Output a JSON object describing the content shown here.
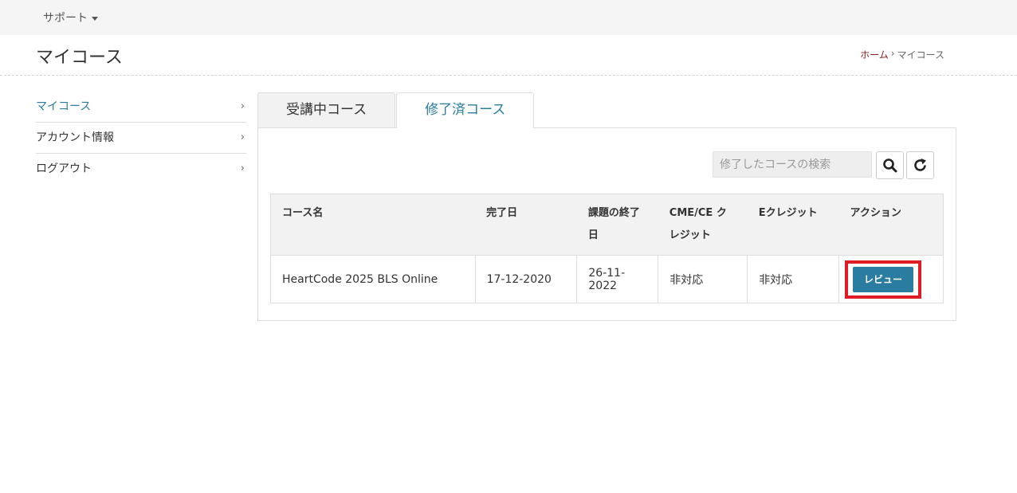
{
  "topbar": {
    "support_label": "サポート"
  },
  "header": {
    "title": "マイコース",
    "breadcrumb": {
      "home": "ホーム",
      "separator": "›",
      "current": "マイコース"
    }
  },
  "sidebar": {
    "items": [
      {
        "label": "マイコース"
      },
      {
        "label": "アカウント情報"
      },
      {
        "label": "ログアウト"
      }
    ],
    "chevron": "›"
  },
  "tabs": [
    {
      "label": "受講中コース"
    },
    {
      "label": "修了済コース"
    }
  ],
  "search": {
    "placeholder": "修了したコースの検索"
  },
  "table": {
    "headers": [
      "コース名",
      "完了日",
      "課題の終了日",
      "CME/CE クレジット",
      "Eクレジット",
      "アクション"
    ],
    "rows": [
      {
        "course": "HeartCode 2025 BLS Online",
        "completed": "17-12-2020",
        "due": "26-11-2022",
        "cme": "非対応",
        "ecredit": "非対応",
        "action": "レビュー"
      }
    ]
  },
  "colors": {
    "accent": "#2a7ca0",
    "highlight": "#e01b24",
    "breadcrumb_home": "#8b1a1a"
  }
}
